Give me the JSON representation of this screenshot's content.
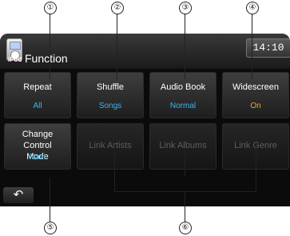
{
  "header": {
    "ipod_label": "iPod",
    "title": "Function",
    "clock": "14:10"
  },
  "grid": {
    "row1": [
      {
        "label": "Repeat",
        "value": "All"
      },
      {
        "label": "Shuffle",
        "value": "Songs"
      },
      {
        "label": "Audio Book",
        "value": "Normal"
      },
      {
        "label": "Widescreen",
        "value": "On"
      }
    ],
    "row2": [
      {
        "label": "Change Control Mode",
        "value": "Navi"
      },
      {
        "label": "Link Artists"
      },
      {
        "label": "Link Albums"
      },
      {
        "label": "Link Genre"
      }
    ]
  },
  "back_icon": "return-arrow-icon",
  "callouts": [
    "①",
    "②",
    "③",
    "④",
    "⑤",
    "⑥"
  ],
  "colors": {
    "value_blue": "#3cb4f0",
    "value_orange": "#f5a623",
    "disabled_text": "#5e5e5e"
  }
}
